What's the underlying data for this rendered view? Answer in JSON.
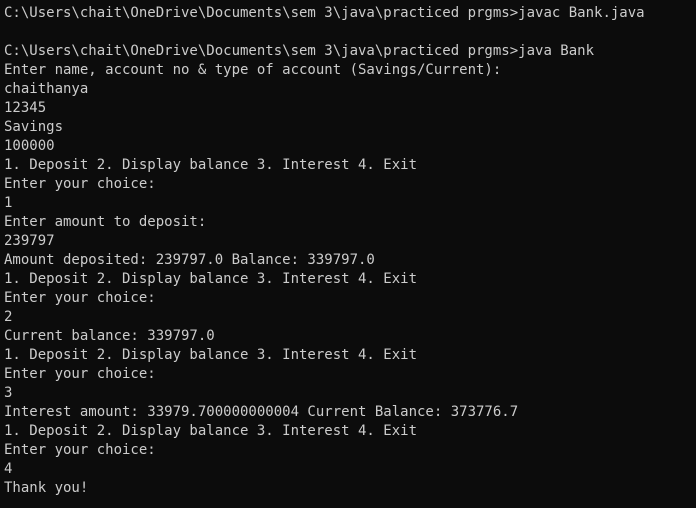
{
  "terminal": {
    "lines": [
      "C:\\Users\\chait\\OneDrive\\Documents\\sem 3\\java\\practiced prgms>javac Bank.java",
      "",
      "C:\\Users\\chait\\OneDrive\\Documents\\sem 3\\java\\practiced prgms>java Bank",
      "Enter name, account no & type of account (Savings/Current):",
      "chaithanya",
      "12345",
      "Savings",
      "100000",
      "1. Deposit 2. Display balance 3. Interest 4. Exit",
      "Enter your choice:",
      "1",
      "Enter amount to deposit:",
      "239797",
      "Amount deposited: 239797.0 Balance: 339797.0",
      "1. Deposit 2. Display balance 3. Interest 4. Exit",
      "Enter your choice:",
      "2",
      "Current balance: 339797.0",
      "1. Deposit 2. Display balance 3. Interest 4. Exit",
      "Enter your choice:",
      "3",
      "Interest amount: 33979.700000000004 Current Balance: 373776.7",
      "1. Deposit 2. Display balance 3. Interest 4. Exit",
      "Enter your choice:",
      "4",
      "Thank you!"
    ]
  }
}
